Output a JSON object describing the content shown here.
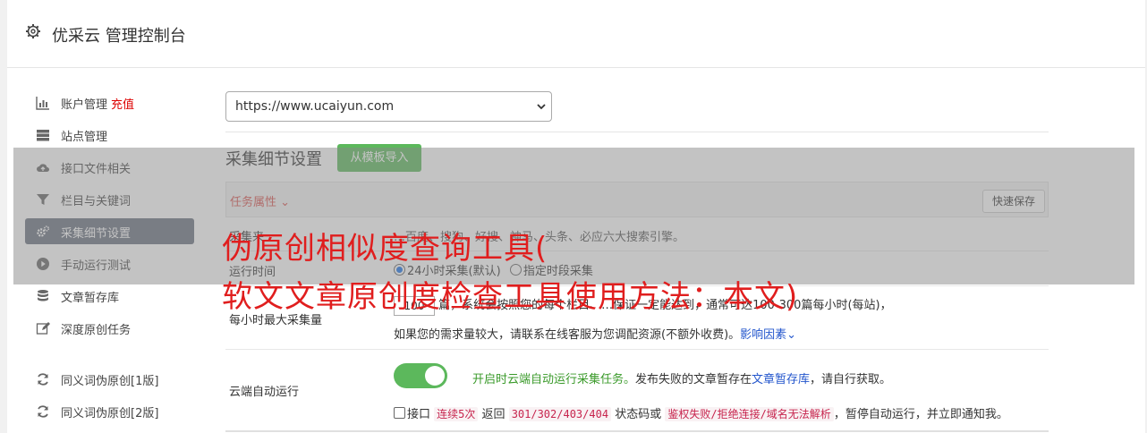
{
  "header": {
    "title": "优采云 管理控制台"
  },
  "sidebar": {
    "items": [
      {
        "label": "账户管理",
        "extra": "充值",
        "icon": "bar-chart-icon"
      },
      {
        "label": "站点管理",
        "icon": "server-icon"
      },
      {
        "label": "接口文件相关",
        "icon": "cloud-upload-icon"
      },
      {
        "label": "栏目与关键词",
        "icon": "filter-icon"
      },
      {
        "label": "采集细节设置",
        "icon": "gears-icon",
        "active": true
      },
      {
        "label": "手动运行测试",
        "icon": "play-circle-icon"
      },
      {
        "label": "文章暂存库",
        "icon": "database-icon"
      },
      {
        "label": "深度原创任务",
        "icon": "edit-icon"
      },
      {
        "label": "同义词伪原创[1版]",
        "icon": "refresh-icon"
      },
      {
        "label": "同义词伪原创[2版]",
        "icon": "refresh-icon"
      }
    ]
  },
  "site_select": {
    "value": "https://www.ucaiyun.com"
  },
  "section": {
    "title": "采集细节设置",
    "import_button": "从模板导入"
  },
  "task_bar": {
    "label": "任务属性 ⌄",
    "save_button": "快速保存"
  },
  "rows": {
    "source": {
      "label": "采集来",
      "text": "…百度、搜狗、好搜、神马、头条、必应六大搜索引擎。"
    },
    "run_time": {
      "label": "运行时间",
      "opt1": "24小时采集(默认)",
      "opt2": "指定时段采集"
    },
    "max_per_hour": {
      "label": "每小时最大采集量",
      "value": "100",
      "line1_a": "篇，系统会按照您的每个栏目、…保证一定能达到，通常可达100-300篇每小时(每站)，",
      "line2_a": "如果您的需求量较大，请联系在线客服为您调配资源(不额外收费)。",
      "line2_link": "影响因素⌄"
    },
    "cloud_run": {
      "label": "云端自动运行",
      "toggle_on": true,
      "line1_green": "开启时云端自动运行采集任务。",
      "line1_b": "发布失败的文章暂存在",
      "line1_link": "文章暂存库",
      "line1_c": "，请自行获取。",
      "line2_a": "接口",
      "line2_code1": "连续5次",
      "line2_b": "返回",
      "line2_code2": "301/302/403/404",
      "line2_c": "状态码或",
      "line2_code3": "鉴权失败/拒绝连接/域名无法解析",
      "line2_d": "，暂停自动运行，并立即通知我。"
    }
  },
  "watermark": {
    "line1": "伪原创相似度查询工具(",
    "line2": "软文文章原创度检查工具使用方法：本文)"
  },
  "colors": {
    "accent": "#5cb85c",
    "active_nav": "#6b7280",
    "watermark": "#e01e1e"
  }
}
